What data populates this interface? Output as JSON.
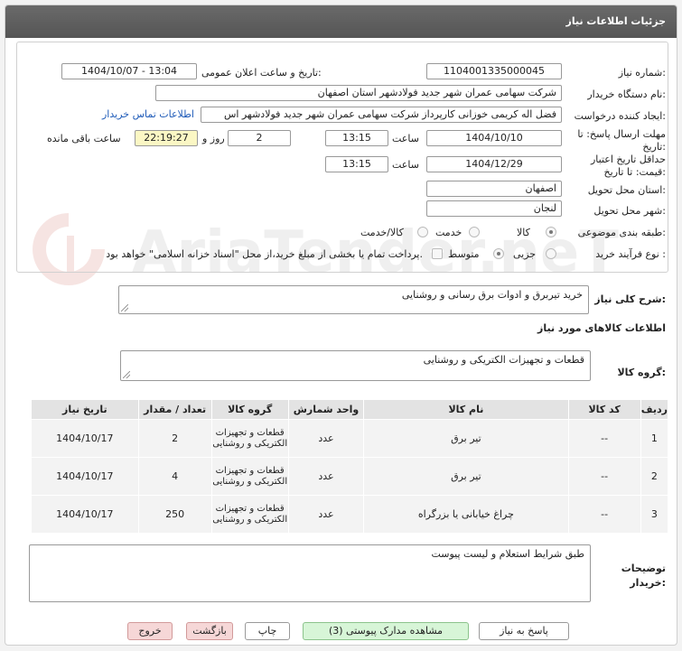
{
  "header": {
    "title": "جزئیات اطلاعات نیاز"
  },
  "fields": {
    "need_number_label": "شماره نیاز:",
    "need_number": "1104001335000045",
    "announce_datetime_label": "تاریخ و ساعت اعلان عمومی:",
    "announce_datetime": "1404/10/07 - 13:04",
    "buyer_org_label": "نام دستگاه خریدار:",
    "buyer_org": "شرکت سهامی عمران شهر جدید فولادشهر استان اصفهان",
    "requester_label": "ایجاد کننده درخواست:",
    "requester": "فضل اله کریمی خوزانی کارپرداز شرکت سهامی عمران شهر جدید فولادشهر اس",
    "contact_link": "اطلاعات تماس خریدار",
    "reply_deadline_label": "مهلت ارسال پاسخ: تا تاریخ:",
    "reply_date": "1404/10/10",
    "time_label": "ساعت",
    "reply_time": "13:15",
    "days_value": "2",
    "days_label": "روز و",
    "remaining_time": "22:19:27",
    "remaining_label": "ساعت باقی مانده",
    "price_validity_label": "حداقل تاریخ اعتبار قیمت: تا تاریخ:",
    "price_validity_date": "1404/12/29",
    "price_validity_time": "13:15",
    "delivery_province_label": "استان محل تحویل:",
    "delivery_province": "اصفهان",
    "delivery_city_label": "شهر محل تحویل:",
    "delivery_city": "لنجان",
    "category_label": "طبقه بندی موضوعی:",
    "category_options": [
      "کالا",
      "خدمت",
      "کالا/خدمت"
    ],
    "process_label": "نوع فرآیند خرید :",
    "process_options": [
      "جزیی",
      "متوسط"
    ],
    "payment_note": "پرداخت تمام یا بخشی از مبلغ خرید،از محل \"اسناد خزانه اسلامی\" خواهد بود."
  },
  "summary": {
    "label": "شرح کلی نیاز:",
    "text": "خرید تیربرق و ادوات برق رسانی و روشنایی"
  },
  "goods": {
    "section_title": "اطلاعات کالاهای مورد نیاز",
    "group_label": "گروه کالا:",
    "group_value": "قطعات و تجهیزات الکتریکی و روشنایی",
    "columns": [
      "ردیف",
      "کد کالا",
      "نام کالا",
      "واحد شمارش",
      "گروه کالا",
      "تعداد / مقدار",
      "تاریخ نیاز"
    ],
    "rows": [
      {
        "idx": "1",
        "code": "--",
        "name": "تیر برق",
        "unit": "عدد",
        "group": "قطعات و تجهیزات الکتریکی و روشنایی",
        "qty": "2",
        "date": "1404/10/17"
      },
      {
        "idx": "2",
        "code": "--",
        "name": "تیر برق",
        "unit": "عدد",
        "group": "قطعات و تجهیزات الکتریکی و روشنایی",
        "qty": "4",
        "date": "1404/10/17"
      },
      {
        "idx": "3",
        "code": "--",
        "name": "چراغ خیابانی یا بزرگراه",
        "unit": "عدد",
        "group": "قطعات و تجهیزات الکتریکی و روشنایی",
        "qty": "250",
        "date": "1404/10/17"
      }
    ]
  },
  "buyer_notes": {
    "label": "توضیحات خریدار:",
    "text": "طبق شرایط استعلام و لیست پیوست"
  },
  "buttons": {
    "reply": "پاسخ به نیاز",
    "view_docs": "مشاهده مدارک پیوستی (3)",
    "print": "چاپ",
    "back": "بازگشت",
    "exit": "خروج"
  },
  "watermark": "AriaTender.neT",
  "colors": {
    "header": "#5f5f5f",
    "link": "#1f5bb8",
    "remaining_bg": "#fbf7c4",
    "green_button": "#d7f5d7",
    "pink_button": "#f6d7d7"
  }
}
